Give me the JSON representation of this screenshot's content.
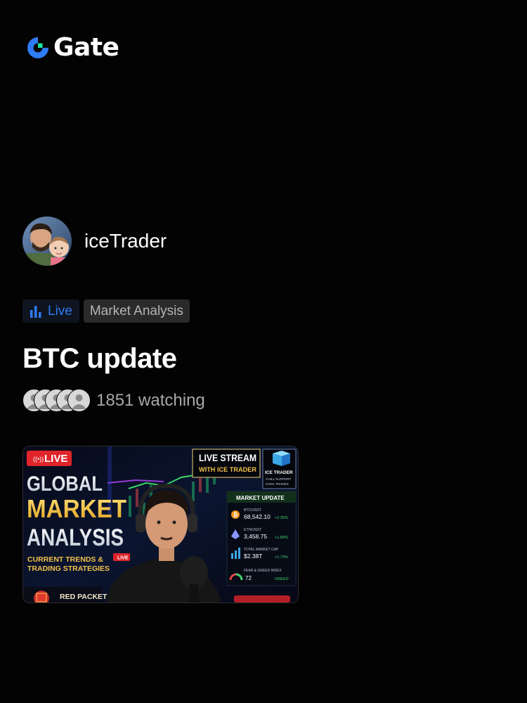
{
  "brand": {
    "name": "Gate",
    "color": "#2f7bf6"
  },
  "streamer": {
    "name": "iceTrader"
  },
  "tags": {
    "live": "Live",
    "category": "Market Analysis"
  },
  "stream": {
    "title": "BTC update",
    "watching": "1851 watching"
  },
  "thumbnail": {
    "live_badge": "LIVE",
    "headline_1": "GLOBAL",
    "headline_2": "MARKET",
    "headline_3": "ANALYSIS",
    "sub_1": "CURRENT TRENDS &",
    "sub_2": "TRADING STRATEGIES",
    "live_small": "LIVE",
    "red_packet": "RED PACKET",
    "box_title_1": "LIVE STREAM",
    "box_title_2": "WITH ICE TRADER",
    "ice_logo_1": "ICE TRADER",
    "ice_logo_2": "CHILL SUPPORT",
    "ice_logo_3": "COOL TRADES",
    "panel_title": "MARKET UPDATE",
    "btc_label": "BTC/USDT",
    "btc_value": "68,542.10",
    "btc_change": "+2.35%",
    "eth_label": "ETH/USDT",
    "eth_value": "3,458.75",
    "eth_change": "+1.89%",
    "cap_label": "TOTAL MARKET CAP",
    "cap_value": "$2.38T",
    "cap_change": "+1.73%",
    "fg_label": "FEAR & GREED INDEX",
    "fg_value": "72",
    "fg_status": "GREED"
  }
}
